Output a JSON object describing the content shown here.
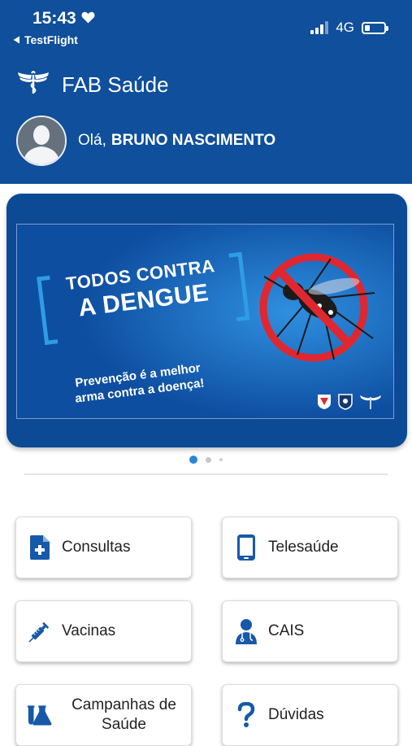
{
  "status_bar": {
    "time": "15:43",
    "back_app": "TestFlight",
    "network": "4G"
  },
  "header": {
    "app_name": "FAB Saúde",
    "greeting_prefix": "Olá,",
    "user_name": "BRUNO NASCIMENTO"
  },
  "banner": {
    "headline_line1": "TODOS CONTRA",
    "headline_line2": "A DENGUE",
    "subtitle_line1": "Prevenção é a melhor",
    "subtitle_line2": "arma contra a doença!"
  },
  "carousel": {
    "pages": 3,
    "active_index": 0
  },
  "menu": [
    {
      "id": "consultas",
      "label": "Consultas",
      "icon": "medical-file-icon"
    },
    {
      "id": "telesaude",
      "label": "Telesaúde",
      "icon": "smartphone-icon"
    },
    {
      "id": "vacinas",
      "label": "Vacinas",
      "icon": "syringe-icon"
    },
    {
      "id": "cais",
      "label": "CAIS",
      "icon": "doctor-icon"
    },
    {
      "id": "campanhas",
      "label_line1": "Campanhas de",
      "label_line2": "Saúde",
      "icon": "flask-icon"
    },
    {
      "id": "duvidas",
      "label": "Dúvidas",
      "icon": "question-icon"
    }
  ],
  "colors": {
    "primary": "#0f4f9b",
    "icon_blue": "#1659a8",
    "banner_red": "#e0272f",
    "accent_light_blue": "#2e9ce6"
  }
}
